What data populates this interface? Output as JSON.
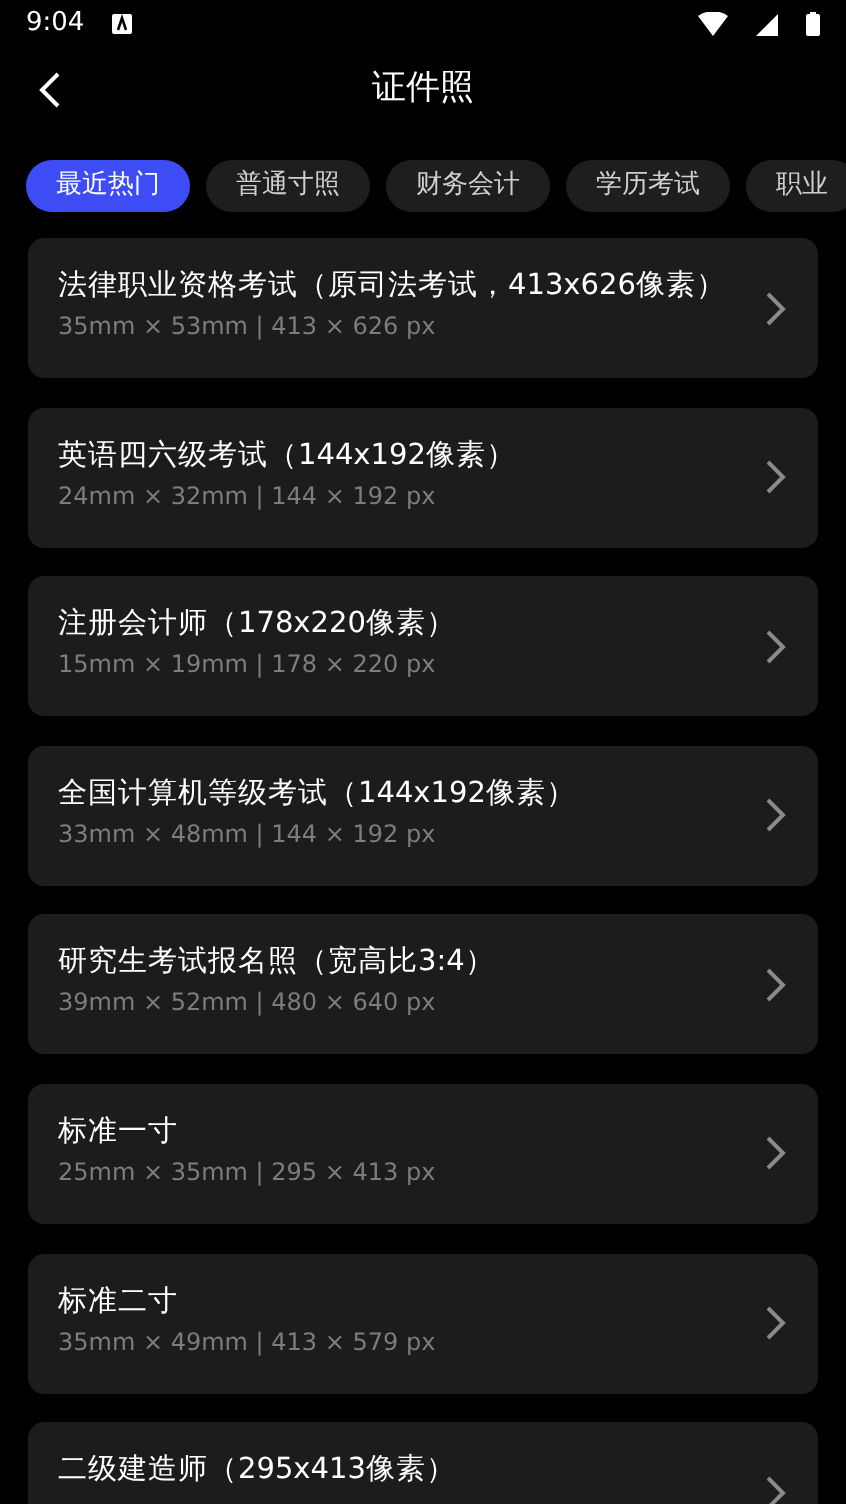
{
  "status_bar": {
    "time": "9:04"
  },
  "header": {
    "title": "证件照"
  },
  "tabs": [
    {
      "label": "最近热门",
      "selected": true
    },
    {
      "label": "普通寸照",
      "selected": false
    },
    {
      "label": "财务会计",
      "selected": false
    },
    {
      "label": "学历考试",
      "selected": false
    },
    {
      "label": "职业",
      "selected": false
    }
  ],
  "items": [
    {
      "title": "法律职业资格考试（原司法考试，413x626像素）",
      "size": "35mm × 53mm | 413 × 626 px"
    },
    {
      "title": "英语四六级考试（144x192像素）",
      "size": "24mm × 32mm | 144 × 192 px"
    },
    {
      "title": "注册会计师（178x220像素）",
      "size": "15mm × 19mm | 178 × 220 px"
    },
    {
      "title": "全国计算机等级考试（144x192像素）",
      "size": "33mm × 48mm | 144 × 192 px"
    },
    {
      "title": "研究生考试报名照（宽高比3:4）",
      "size": "39mm × 52mm | 480 × 640 px"
    },
    {
      "title": "标准一寸",
      "size": "25mm × 35mm | 295 × 413 px"
    },
    {
      "title": "标准二寸",
      "size": "35mm × 49mm | 413 × 579 px"
    },
    {
      "title": "二级建造师（295x413像素）"
    }
  ]
}
